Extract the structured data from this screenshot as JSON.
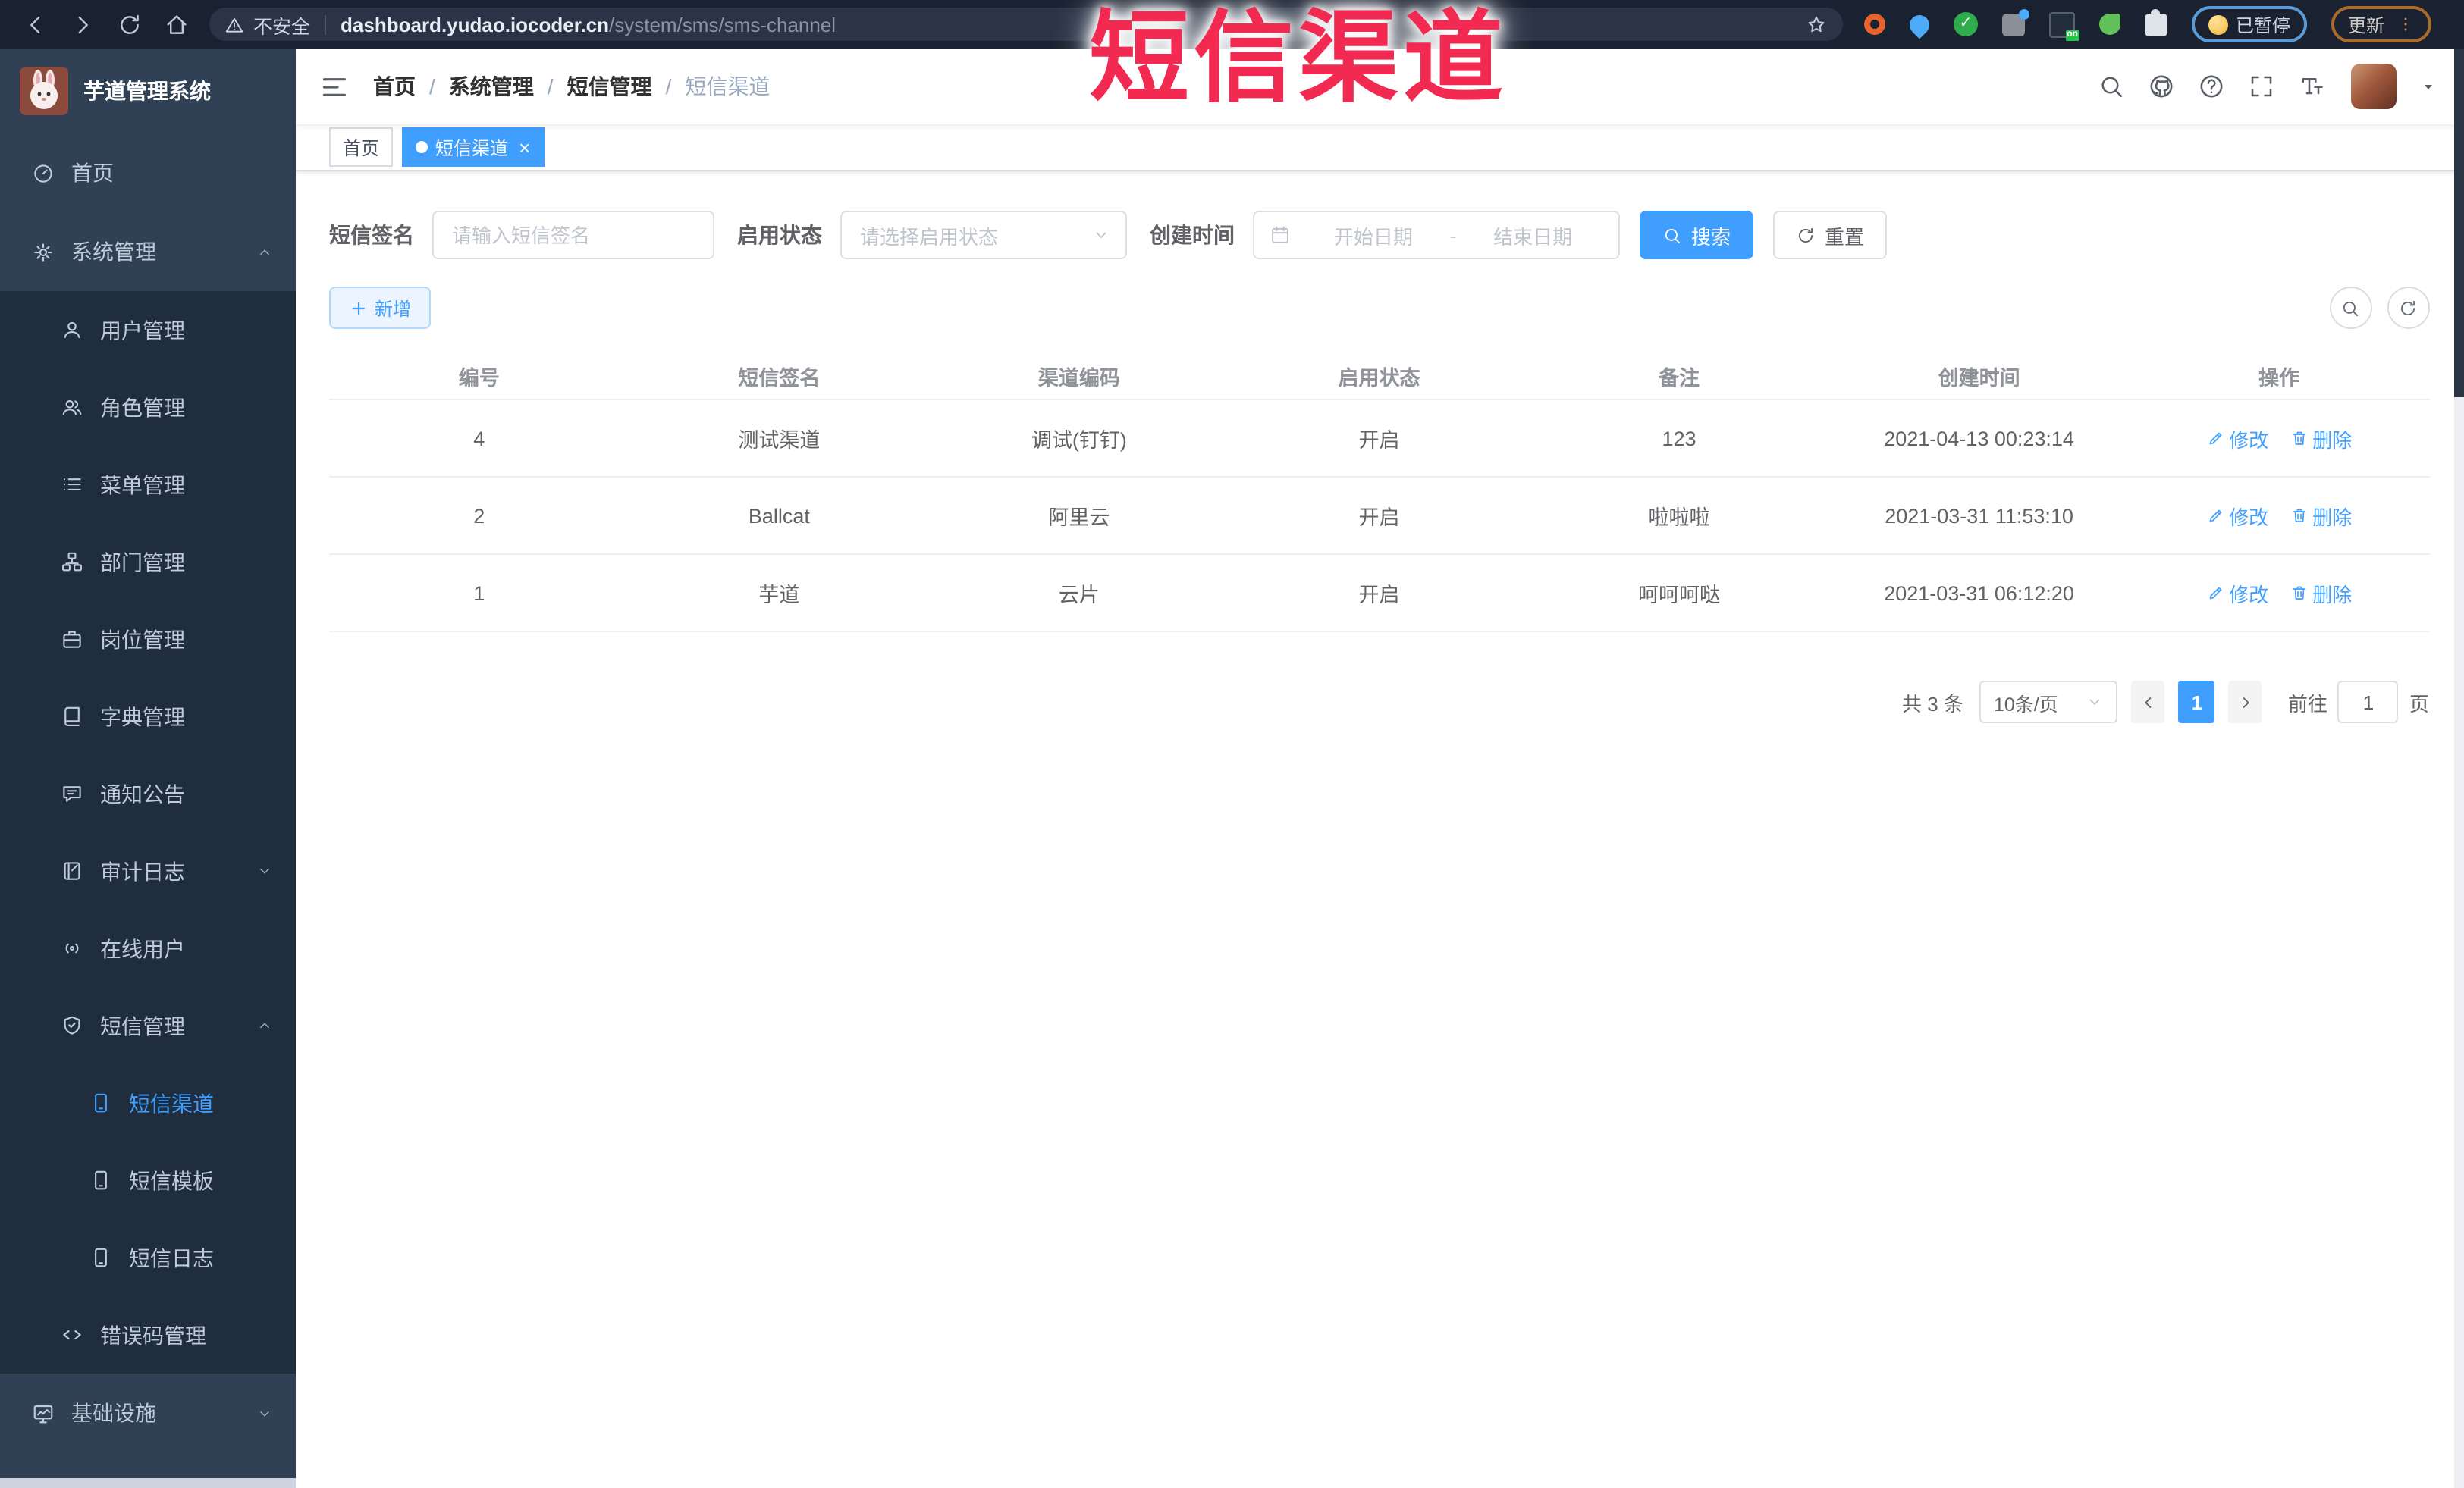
{
  "browser": {
    "security_label": "不安全",
    "url_domain": "dashboard.yudao.iocoder.cn",
    "url_path": "/system/sms/sms-channel",
    "paused_label": "已暂停",
    "update_label": "更新",
    "ext_on_badge": "on",
    "nav_icons": [
      "back",
      "forward",
      "reload",
      "home"
    ],
    "accent_paused_border": "#5b9bd5",
    "accent_update_border": "#a96a2c"
  },
  "overlay": {
    "title": "短信渠道",
    "color": "#f22950"
  },
  "sidebar": {
    "app_title": "芋道管理系统",
    "logo_icon": "rabbit-logo",
    "items": [
      {
        "label": "首页",
        "icon": "dashboard-icon",
        "level": 1
      },
      {
        "label": "系统管理",
        "icon": "gear-icon",
        "level": 1,
        "chevron": "up"
      },
      {
        "label": "用户管理",
        "icon": "user-icon",
        "level": 2
      },
      {
        "label": "角色管理",
        "icon": "users-icon",
        "level": 2
      },
      {
        "label": "菜单管理",
        "icon": "list-icon",
        "level": 2
      },
      {
        "label": "部门管理",
        "icon": "tree-icon",
        "level": 2
      },
      {
        "label": "岗位管理",
        "icon": "briefcase-icon",
        "level": 2
      },
      {
        "label": "字典管理",
        "icon": "book-icon",
        "level": 2
      },
      {
        "label": "通知公告",
        "icon": "notice-icon",
        "level": 2
      },
      {
        "label": "审计日志",
        "icon": "log-icon",
        "level": 2,
        "chevron": "down"
      },
      {
        "label": "在线用户",
        "icon": "online-icon",
        "level": 2
      },
      {
        "label": "短信管理",
        "icon": "shield-icon",
        "level": 2,
        "chevron": "up"
      },
      {
        "label": "短信渠道",
        "icon": "phone-icon",
        "level": 3,
        "active": true
      },
      {
        "label": "短信模板",
        "icon": "phone-icon",
        "level": 3
      },
      {
        "label": "短信日志",
        "icon": "phone-icon",
        "level": 3
      },
      {
        "label": "错误码管理",
        "icon": "code-icon",
        "level": 2
      },
      {
        "label": "基础设施",
        "icon": "monitor-icon",
        "level": 1,
        "chevron": "down"
      }
    ],
    "colors": {
      "bg": "#304156",
      "submenu_bg": "#1f2d3d",
      "active": "#409eff"
    }
  },
  "header": {
    "breadcrumb": [
      "首页",
      "系统管理",
      "短信管理",
      "短信渠道"
    ],
    "icons": [
      "search",
      "github",
      "question",
      "fullscreen",
      "font-size",
      "avatar",
      "caret-down"
    ]
  },
  "tabs": [
    {
      "label": "首页",
      "active": false
    },
    {
      "label": "短信渠道",
      "active": true,
      "close_glyph": "×"
    }
  ],
  "filters": {
    "sign_label": "短信签名",
    "sign_placeholder": "请输入短信签名",
    "status_label": "启用状态",
    "status_placeholder": "请选择启用状态",
    "time_label": "创建时间",
    "start_placeholder": "开始日期",
    "range_separator": "-",
    "end_placeholder": "结束日期",
    "search_label": "搜索",
    "reset_label": "重置"
  },
  "toolbar": {
    "add_label": "新增",
    "right_icons": [
      "show-search",
      "refresh"
    ]
  },
  "table": {
    "columns": [
      "编号",
      "短信签名",
      "渠道编码",
      "启用状态",
      "备注",
      "创建时间",
      "操作"
    ],
    "rows": [
      {
        "id": "4",
        "sign": "测试渠道",
        "code": "调试(钉钉)",
        "status": "开启",
        "remark": "123",
        "created": "2021-04-13 00:23:14"
      },
      {
        "id": "2",
        "sign": "Ballcat",
        "code": "阿里云",
        "status": "开启",
        "remark": "啦啦啦",
        "created": "2021-03-31 11:53:10"
      },
      {
        "id": "1",
        "sign": "芋道",
        "code": "云片",
        "status": "开启",
        "remark": "呵呵呵哒",
        "created": "2021-03-31 06:12:20"
      }
    ],
    "actions": {
      "edit": "修改",
      "delete": "删除"
    }
  },
  "pagination": {
    "total_text": "共 3 条",
    "page_size": "10条/页",
    "current_page": "1",
    "goto_label": "前往",
    "goto_value": "1",
    "page_suffix": "页"
  },
  "colors": {
    "primary": "#409eff"
  }
}
